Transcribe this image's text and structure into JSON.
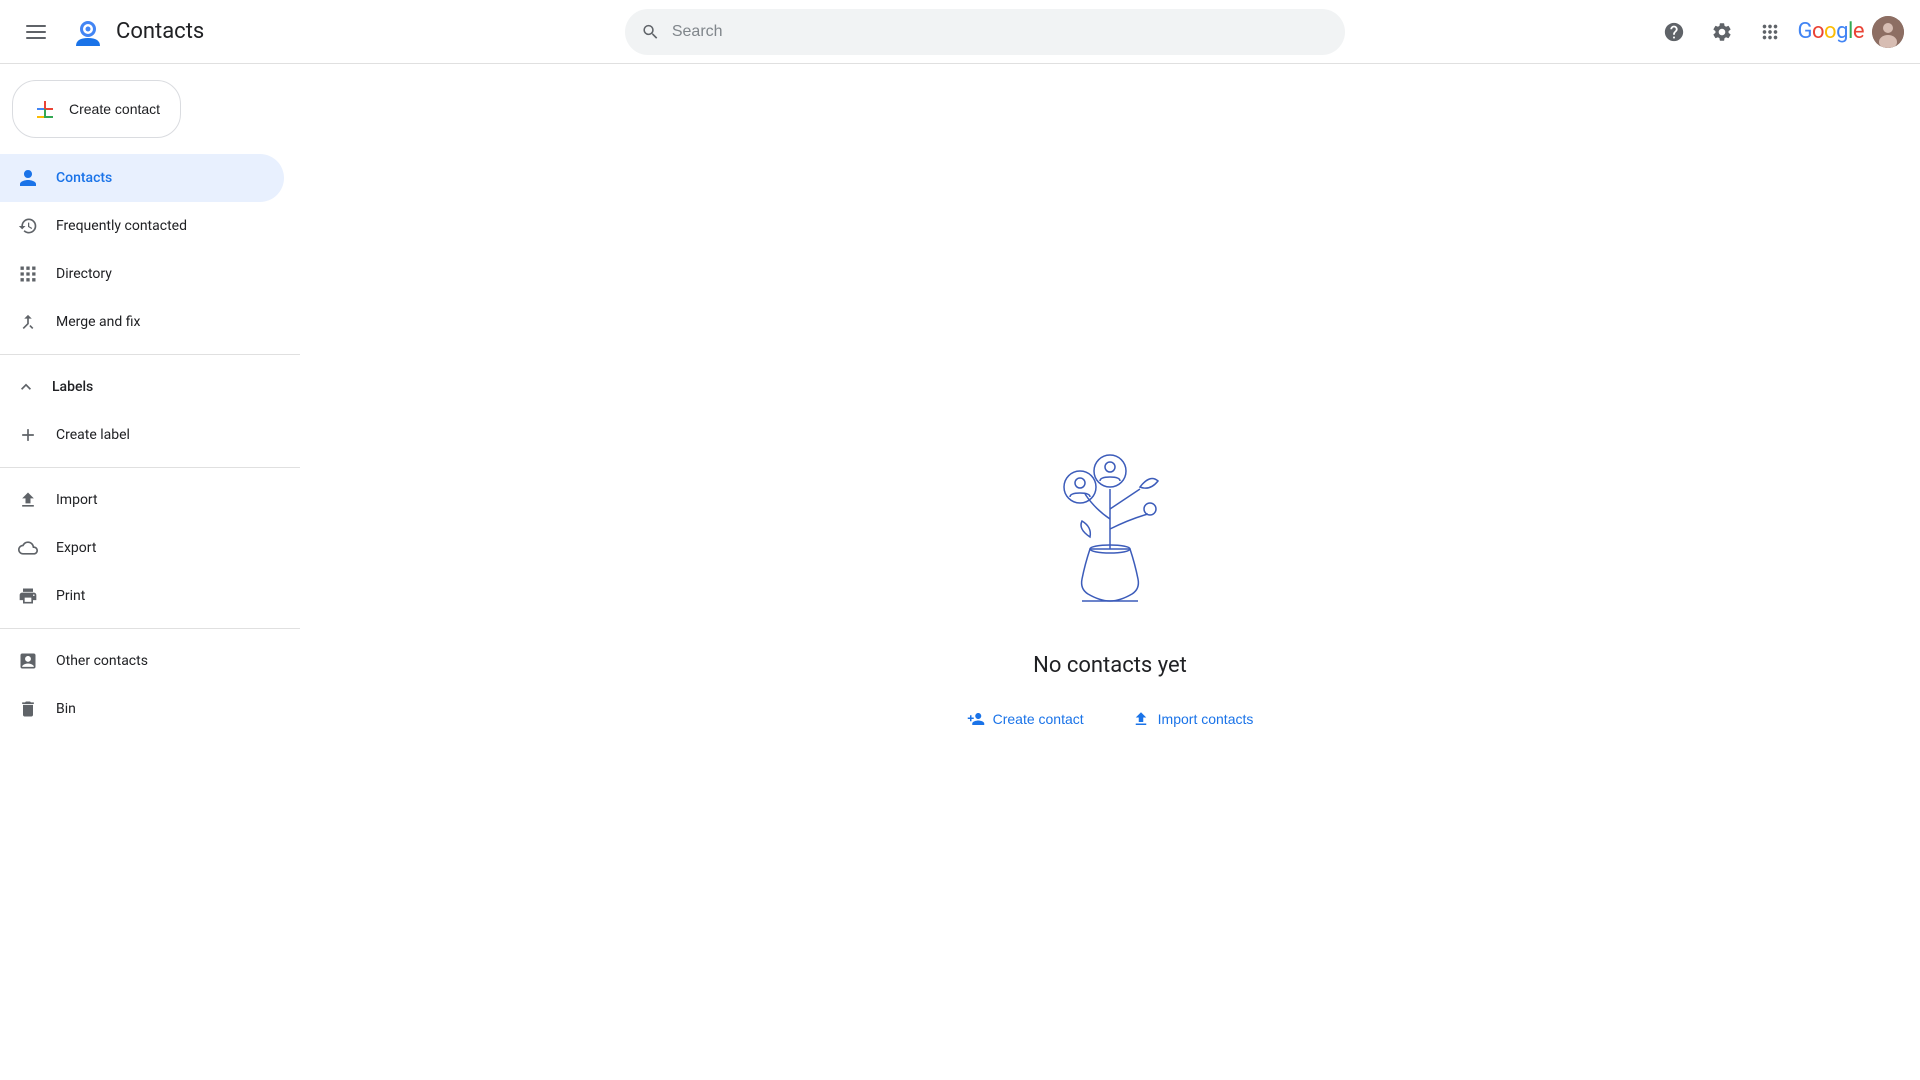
{
  "app": {
    "title": "Contacts",
    "logo_alt": "Google Contacts"
  },
  "header": {
    "search_placeholder": "Search",
    "help_icon": "help-circle-icon",
    "settings_icon": "gear-icon",
    "apps_icon": "grid-icon",
    "google_label": "Google"
  },
  "create_contact": {
    "label": "Create contact"
  },
  "sidebar": {
    "nav_items": [
      {
        "id": "contacts",
        "label": "Contacts",
        "icon": "person-icon",
        "active": true
      },
      {
        "id": "frequently-contacted",
        "label": "Frequently contacted",
        "icon": "history-icon",
        "active": false
      },
      {
        "id": "directory",
        "label": "Directory",
        "icon": "grid-small-icon",
        "active": false
      },
      {
        "id": "merge-and-fix",
        "label": "Merge and fix",
        "icon": "merge-icon",
        "active": false
      }
    ],
    "labels_section": {
      "label": "Labels",
      "expanded": true
    },
    "create_label": "Create label",
    "divider_items": [
      {
        "id": "import",
        "label": "Import",
        "icon": "upload-icon"
      },
      {
        "id": "export",
        "label": "Export",
        "icon": "cloud-upload-icon"
      },
      {
        "id": "print",
        "label": "Print",
        "icon": "print-icon"
      }
    ],
    "other_items": [
      {
        "id": "other-contacts",
        "label": "Other contacts",
        "icon": "person-box-icon"
      },
      {
        "id": "bin",
        "label": "Bin",
        "icon": "trash-icon"
      }
    ]
  },
  "main": {
    "empty_state": {
      "title": "No contacts yet",
      "create_label": "Create contact",
      "import_label": "Import contacts"
    }
  }
}
